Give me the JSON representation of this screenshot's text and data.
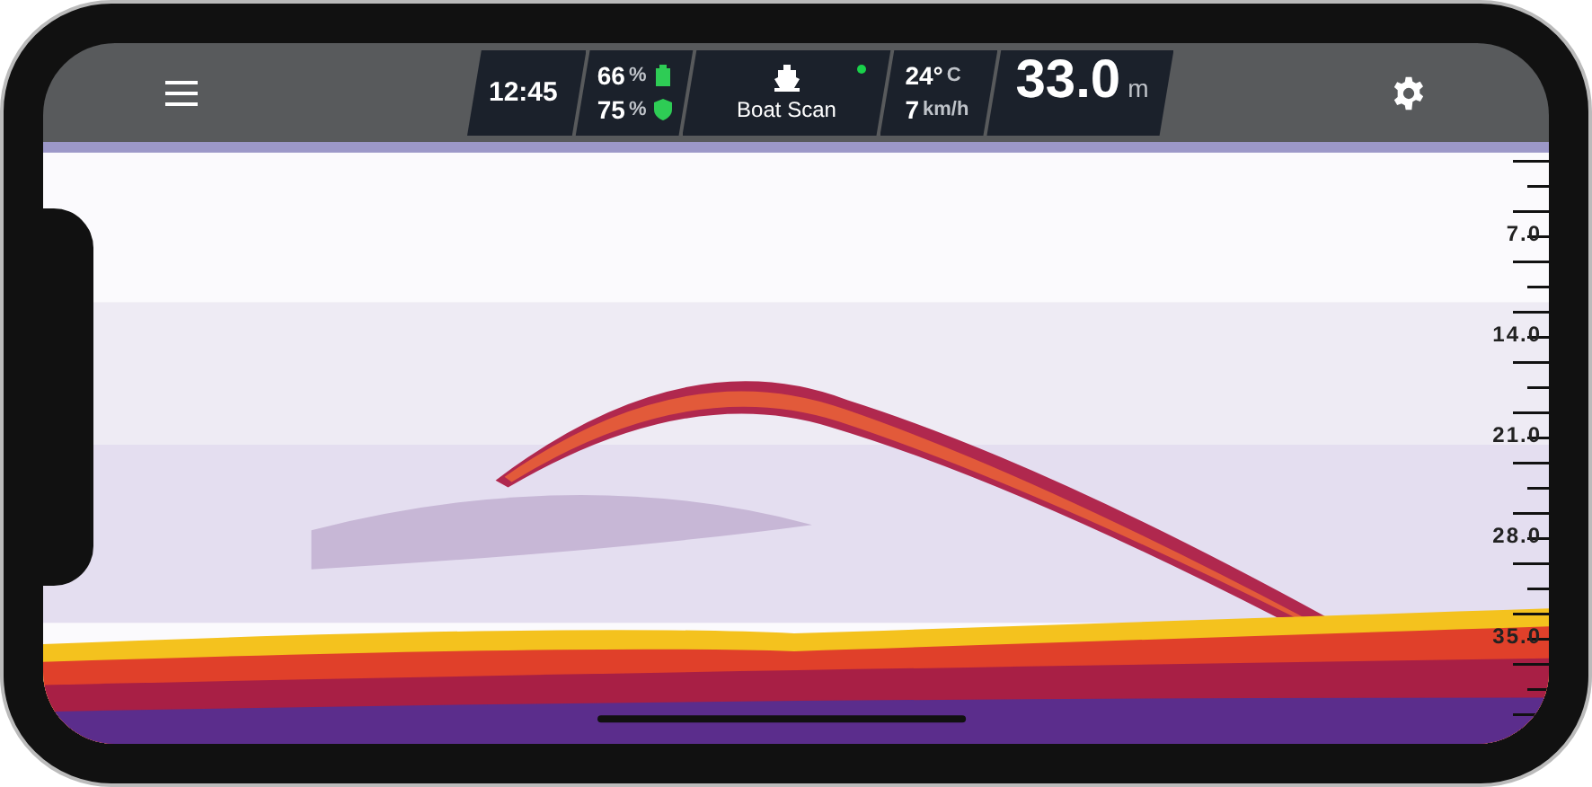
{
  "status_bar": {
    "time": "12:45",
    "batteries": [
      {
        "value": "66",
        "unit": "%",
        "kind": "battery"
      },
      {
        "value": "75",
        "unit": "%",
        "kind": "shield"
      }
    ],
    "mode": {
      "label": "Boat Scan",
      "connected": true
    },
    "temperature": {
      "value": "24°",
      "unit": "C"
    },
    "speed": {
      "value": "7",
      "unit": "km/h"
    },
    "depth": {
      "value": "33.0",
      "unit": "m"
    }
  },
  "sonar": {
    "kind": "picture",
    "depth_scale": [
      "7.0",
      "14.0",
      "21.0",
      "28.0",
      "35.0"
    ]
  }
}
